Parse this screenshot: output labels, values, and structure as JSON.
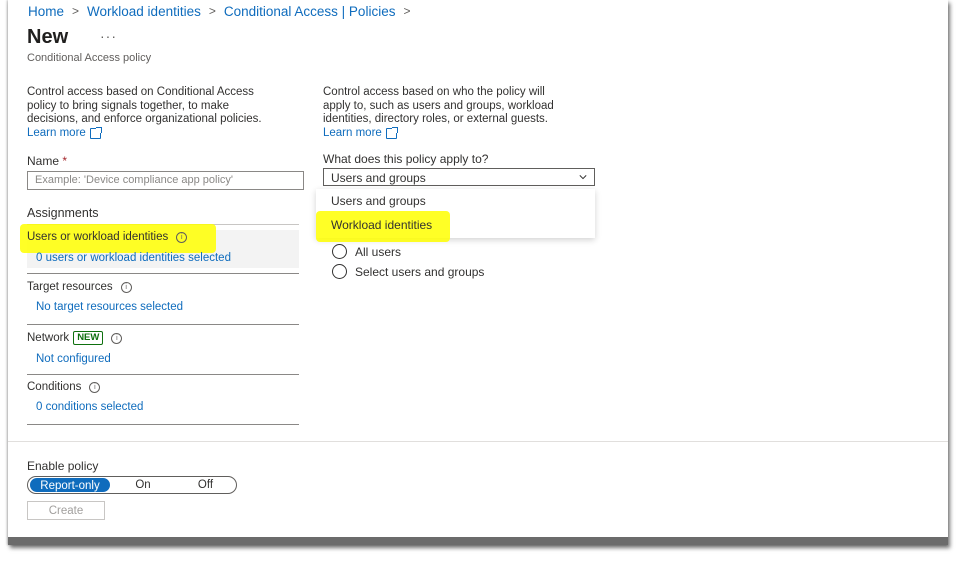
{
  "breadcrumb": [
    "Home",
    "Workload identities",
    "Conditional Access | Policies"
  ],
  "page": {
    "title": "New",
    "ellipsis": "···",
    "subtitle": "Conditional Access policy"
  },
  "left_description": {
    "lines": [
      "Control access based on Conditional Access",
      "policy to bring signals together, to make",
      "decisions, and enforce organizational policies."
    ],
    "learn_more": "Learn more"
  },
  "right_description": {
    "lines": [
      "Control access based on who the policy will",
      "apply to, such as users and groups, workload",
      "identities, directory roles, or external guests."
    ],
    "learn_more": "Learn more"
  },
  "name_field": {
    "label": "Name",
    "required_mark": "*",
    "placeholder": "Example: 'Device compliance app policy'"
  },
  "assignments": {
    "title": "Assignments",
    "items": [
      {
        "label": "Users or workload identities",
        "value": "0 users or workload identities selected"
      },
      {
        "label": "Target resources",
        "value": "No target resources selected"
      },
      {
        "label": "Network",
        "badge": "NEW",
        "value": "Not configured"
      },
      {
        "label": "Conditions",
        "value": "0 conditions selected"
      }
    ]
  },
  "apply_to": {
    "label": "What does this policy apply to?",
    "selected": "Users and groups",
    "options": [
      "Users and groups",
      "Workload identities"
    ]
  },
  "radios": [
    "All users",
    "Select users and groups"
  ],
  "enable_policy": {
    "label": "Enable policy",
    "options": [
      "Report-only",
      "On",
      "Off"
    ],
    "selected": "Report-only"
  },
  "create_button": "Create",
  "colors": {
    "accent": "#0f6cbd",
    "highlight": "#ffff00",
    "new_badge": "#0e700e"
  }
}
